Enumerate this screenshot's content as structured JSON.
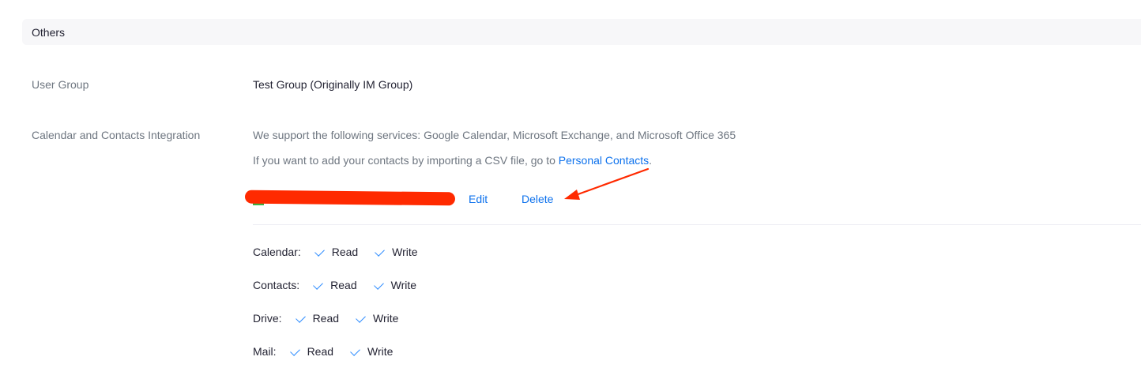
{
  "section": {
    "title": "Others"
  },
  "user_group": {
    "label": "User Group",
    "value": "Test Group (Originally IM Group)"
  },
  "integration": {
    "label": "Calendar and Contacts Integration",
    "support_text": "We support the following services: Google Calendar, Microsoft Exchange, and Microsoft Office 365",
    "csv_prefix": "If you want to add your contacts by importing a CSV file, go to ",
    "csv_link": "Personal Contacts",
    "csv_suffix": ".",
    "edit_label": "Edit",
    "delete_label": "Delete",
    "permissions": [
      {
        "label": "Calendar:",
        "read": "Read",
        "write": "Write"
      },
      {
        "label": "Contacts:",
        "read": "Read",
        "write": "Write"
      },
      {
        "label": "Drive:",
        "read": "Read",
        "write": "Write"
      },
      {
        "label": "Mail:",
        "read": "Read",
        "write": "Write"
      }
    ]
  },
  "colors": {
    "link": "#0e72ed",
    "check": "#2d8cff",
    "annotation": "#ff2a00"
  },
  "icons": {
    "check": "check-icon",
    "annotation": "red-arrow-annotation"
  }
}
